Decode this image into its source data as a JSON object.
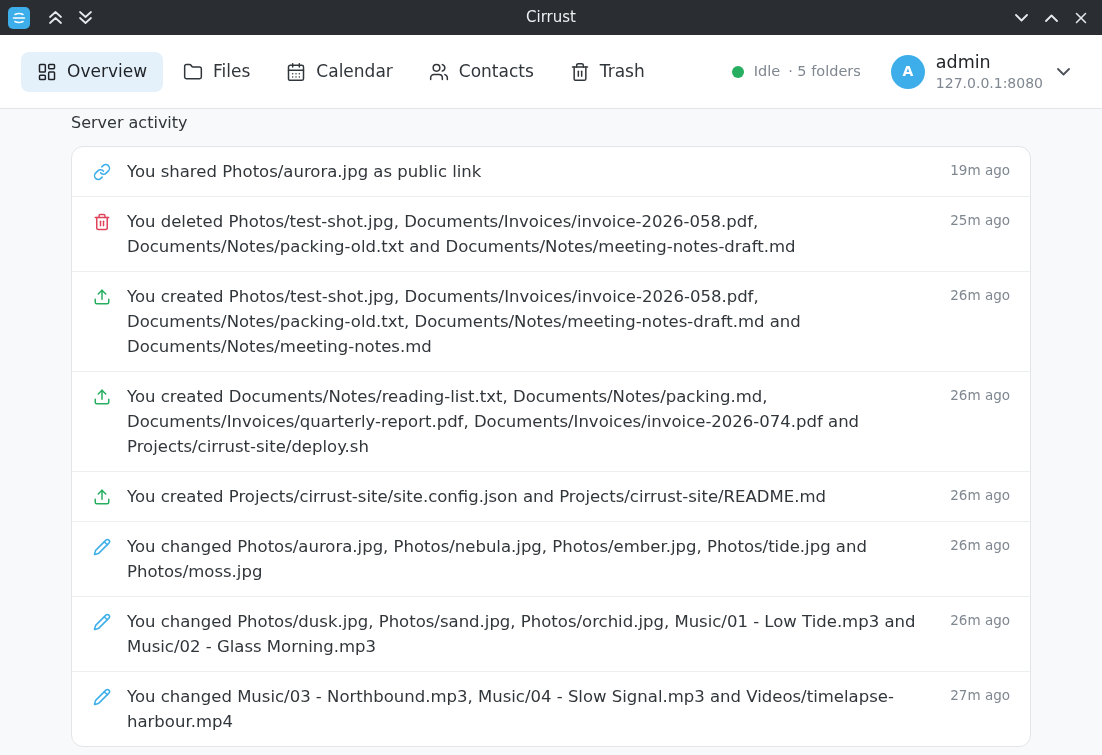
{
  "window": {
    "title": "Cirrust"
  },
  "nav": {
    "tabs": [
      {
        "kind": "overview",
        "label": "Overview",
        "selected": true
      },
      {
        "kind": "files",
        "label": "Files",
        "selected": false
      },
      {
        "kind": "calendar",
        "label": "Calendar",
        "selected": false
      },
      {
        "kind": "contacts",
        "label": "Contacts",
        "selected": false
      },
      {
        "kind": "trash",
        "label": "Trash",
        "selected": false
      }
    ]
  },
  "status": {
    "connected": true,
    "label": "Idle",
    "folders": "· 5 folders"
  },
  "account": {
    "initial": "A",
    "name": "admin",
    "address": "127.0.0.1:8080"
  },
  "activity": {
    "title": "Server activity",
    "items": [
      {
        "kind": "share",
        "text": "You shared Photos/aurora.jpg as public link",
        "time": "19m ago"
      },
      {
        "kind": "delete",
        "text": "You deleted Photos/test-shot.jpg, Documents/Invoices/invoice-2026-058.pdf, Documents/Notes/packing-old.txt and Documents/Notes/meeting-notes-draft.md",
        "time": "25m ago"
      },
      {
        "kind": "create",
        "text": "You created Photos/test-shot.jpg, Documents/Invoices/invoice-2026-058.pdf, Documents/Notes/packing-old.txt, Documents/Notes/meeting-notes-draft.md and Documents/Notes/meeting-notes.md",
        "time": "26m ago"
      },
      {
        "kind": "create",
        "text": "You created Documents/Notes/reading-list.txt, Documents/Notes/packing.md, Documents/Invoices/quarterly-report.pdf, Documents/Invoices/invoice-2026-074.pdf and Projects/cirrust-site/deploy.sh",
        "time": "26m ago"
      },
      {
        "kind": "create",
        "text": "You created Projects/cirrust-site/site.config.json and Projects/cirrust-site/README.md",
        "time": "26m ago"
      },
      {
        "kind": "edit",
        "text": "You changed Photos/aurora.jpg, Photos/nebula.jpg, Photos/ember.jpg, Photos/tide.jpg and Photos/moss.jpg",
        "time": "26m ago"
      },
      {
        "kind": "edit",
        "text": "You changed Photos/dusk.jpg, Photos/sand.jpg, Photos/orchid.jpg, Music/01 - Low Tide.mp3 and Music/02 - Glass Morning.mp3",
        "time": "26m ago"
      },
      {
        "kind": "edit",
        "text": "You changed Music/03 - Northbound.mp3, Music/04 - Slow Signal.mp3 and Videos/timelapse-harbour.mp4",
        "time": "27m ago"
      }
    ]
  }
}
